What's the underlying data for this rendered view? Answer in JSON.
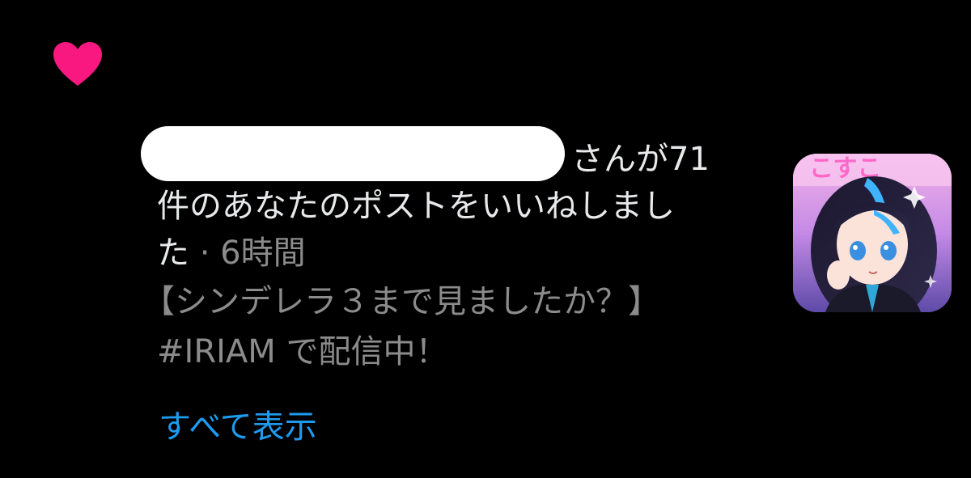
{
  "notification": {
    "icon": "heart-icon",
    "accent_color": "#f91880",
    "text_suffix": "さんが71",
    "text_line2": "件のあなたのポストをいいねしまし",
    "text_line3": "た",
    "separator": " · ",
    "time_ago": "6時間",
    "post_title": "【シンデレラ３まで見ましたか？】",
    "post_tag_line": "#IRIAM で配信中！",
    "show_all_label": "すべて表示",
    "link_color": "#1d9bf0"
  }
}
